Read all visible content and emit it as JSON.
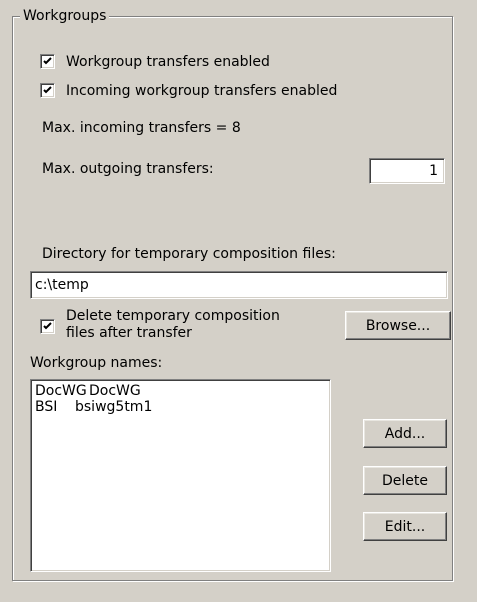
{
  "groupbox": {
    "title": "Workgroups"
  },
  "checkboxes": {
    "transfers_enabled": {
      "label": "Workgroup transfers enabled",
      "checked": true
    },
    "incoming_enabled": {
      "label": "Incoming workgroup transfers enabled",
      "checked": true
    },
    "delete_temp": {
      "label_line1": "Delete temporary composition",
      "label_line2": "files after transfer",
      "checked": true
    }
  },
  "max_incoming": {
    "text": "Max. incoming transfers = 8"
  },
  "max_outgoing": {
    "label": "Max. outgoing transfers:",
    "value": "1"
  },
  "temp_dir": {
    "label": "Directory for temporary composition files:",
    "value": "c:\\temp"
  },
  "buttons": {
    "browse": "Browse...",
    "add": "Add...",
    "delete": "Delete",
    "edit": "Edit..."
  },
  "workgroups": {
    "label": "Workgroup names:",
    "items": [
      {
        "name": "DocWG",
        "value": "DocWG"
      },
      {
        "name": "BSI",
        "value": "bsiwg5tm1"
      }
    ]
  },
  "icons": {
    "check": "check-mark-icon"
  }
}
